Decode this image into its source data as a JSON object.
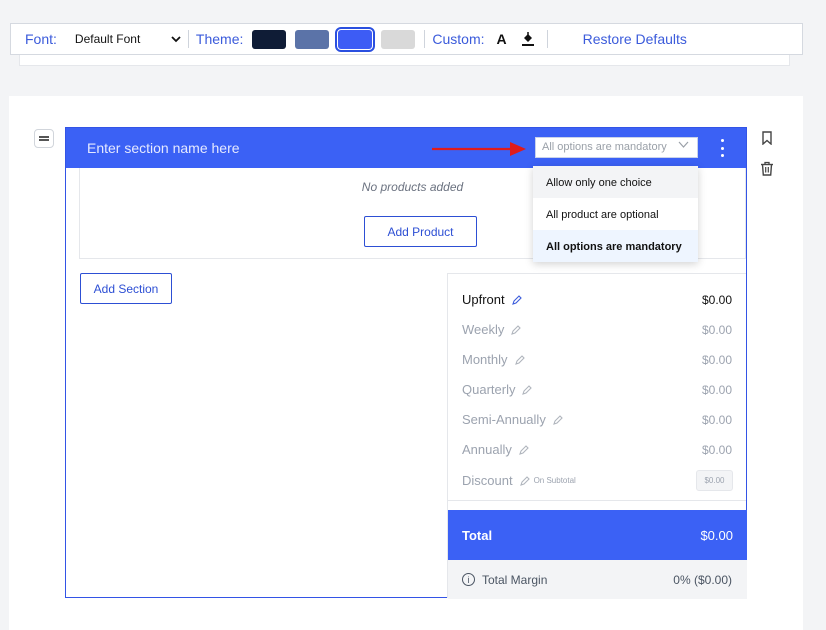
{
  "toolbar": {
    "font_label": "Font:",
    "font_value": "Default Font",
    "theme_label": "Theme:",
    "theme_swatches": [
      "#0f1c36",
      "#5b73a8",
      "#3d5cf5",
      "#d9d9d9"
    ],
    "custom_label": "Custom:",
    "custom_text_icon": "A",
    "restore_label": "Restore Defaults"
  },
  "section": {
    "name_placeholder": "Enter section name here",
    "option_selected": "All options are mandatory",
    "no_products": "No products added",
    "add_product": "Add Product",
    "add_section": "Add Section"
  },
  "dropdown": {
    "options": [
      "Allow only one choice",
      "All product are optional",
      "All options are mandatory"
    ]
  },
  "summary": {
    "rows": [
      {
        "label": "Upfront",
        "value": "$0.00"
      },
      {
        "label": "Weekly",
        "value": "$0.00"
      },
      {
        "label": "Monthly",
        "value": "$0.00"
      },
      {
        "label": "Quarterly",
        "value": "$0.00"
      },
      {
        "label": "Semi-Annually",
        "value": "$0.00"
      },
      {
        "label": "Annually",
        "value": "$0.00"
      }
    ],
    "discount_label": "Discount",
    "discount_note": "On Subtotal",
    "discount_value": "$0.00",
    "total_label": "Total",
    "total_value": "$0.00",
    "margin_label": "Total Margin",
    "margin_value": "0% ($0.00)"
  },
  "colors": {
    "accent": "#3b61f5",
    "arrow": "#e01b1b"
  }
}
